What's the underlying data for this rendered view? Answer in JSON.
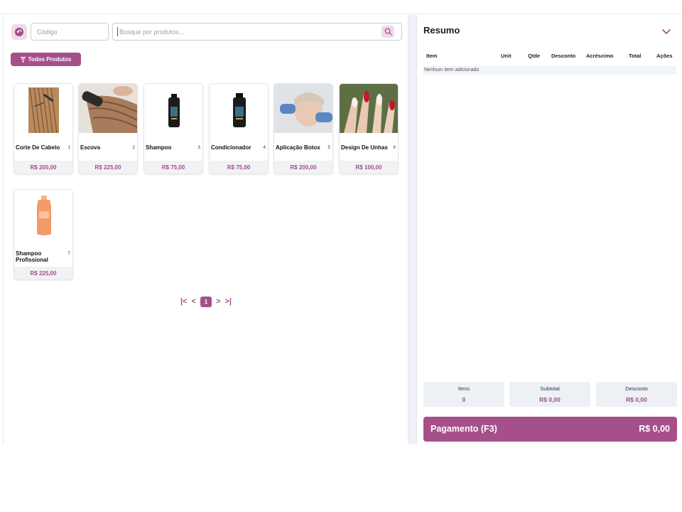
{
  "toolbar": {
    "code_placeholder": "Código",
    "search_placeholder": "Busque por produtos...",
    "filter_label": "Todos Produtos"
  },
  "products": [
    {
      "name": "Corte De Cabelo",
      "number": "1",
      "price": "R$ 200,00",
      "image": "hair-cut-photo"
    },
    {
      "name": "Escova",
      "number": "2",
      "price": "R$ 225,00",
      "image": "hair-brushing-photo"
    },
    {
      "name": "Shampoo",
      "number": "3",
      "price": "R$ 75,00",
      "image": "shampoo-bottle-photo"
    },
    {
      "name": "Condicionador",
      "number": "4",
      "price": "R$ 75,00",
      "image": "conditioner-bottle-photo"
    },
    {
      "name": "Aplicação Botox",
      "number": "5",
      "price": "R$ 200,00",
      "image": "botox-application-photo"
    },
    {
      "name": "Design De Unhas",
      "number": "6",
      "price": "R$ 100,00",
      "image": "nail-design-photo"
    },
    {
      "name": "Shampoo Profissional",
      "number": "7",
      "price": "R$ 225,00",
      "image": "professional-shampoo-photo"
    }
  ],
  "pagination": {
    "first": "|<",
    "prev": "<",
    "current": "1",
    "next": ">",
    "last": ">|"
  },
  "summary": {
    "title": "Resumo",
    "columns": [
      "Item",
      "Unit",
      "Qtde",
      "Desconto",
      "Acréscimo",
      "Total",
      "Ações"
    ],
    "empty_text": "Nenhum item adicionado",
    "totals": [
      {
        "label": "Itens",
        "value": "0"
      },
      {
        "label": "Subtotal",
        "value": "R$ 0,00"
      },
      {
        "label": "Desconto",
        "value": "R$ 0,00"
      }
    ],
    "payment_label": "Pagamento (F3)",
    "payment_total": "R$ 0,00"
  },
  "colors": {
    "accent": "#a6508b",
    "accent_light": "#f1d8ea",
    "panel_gray": "#edf0f5"
  }
}
